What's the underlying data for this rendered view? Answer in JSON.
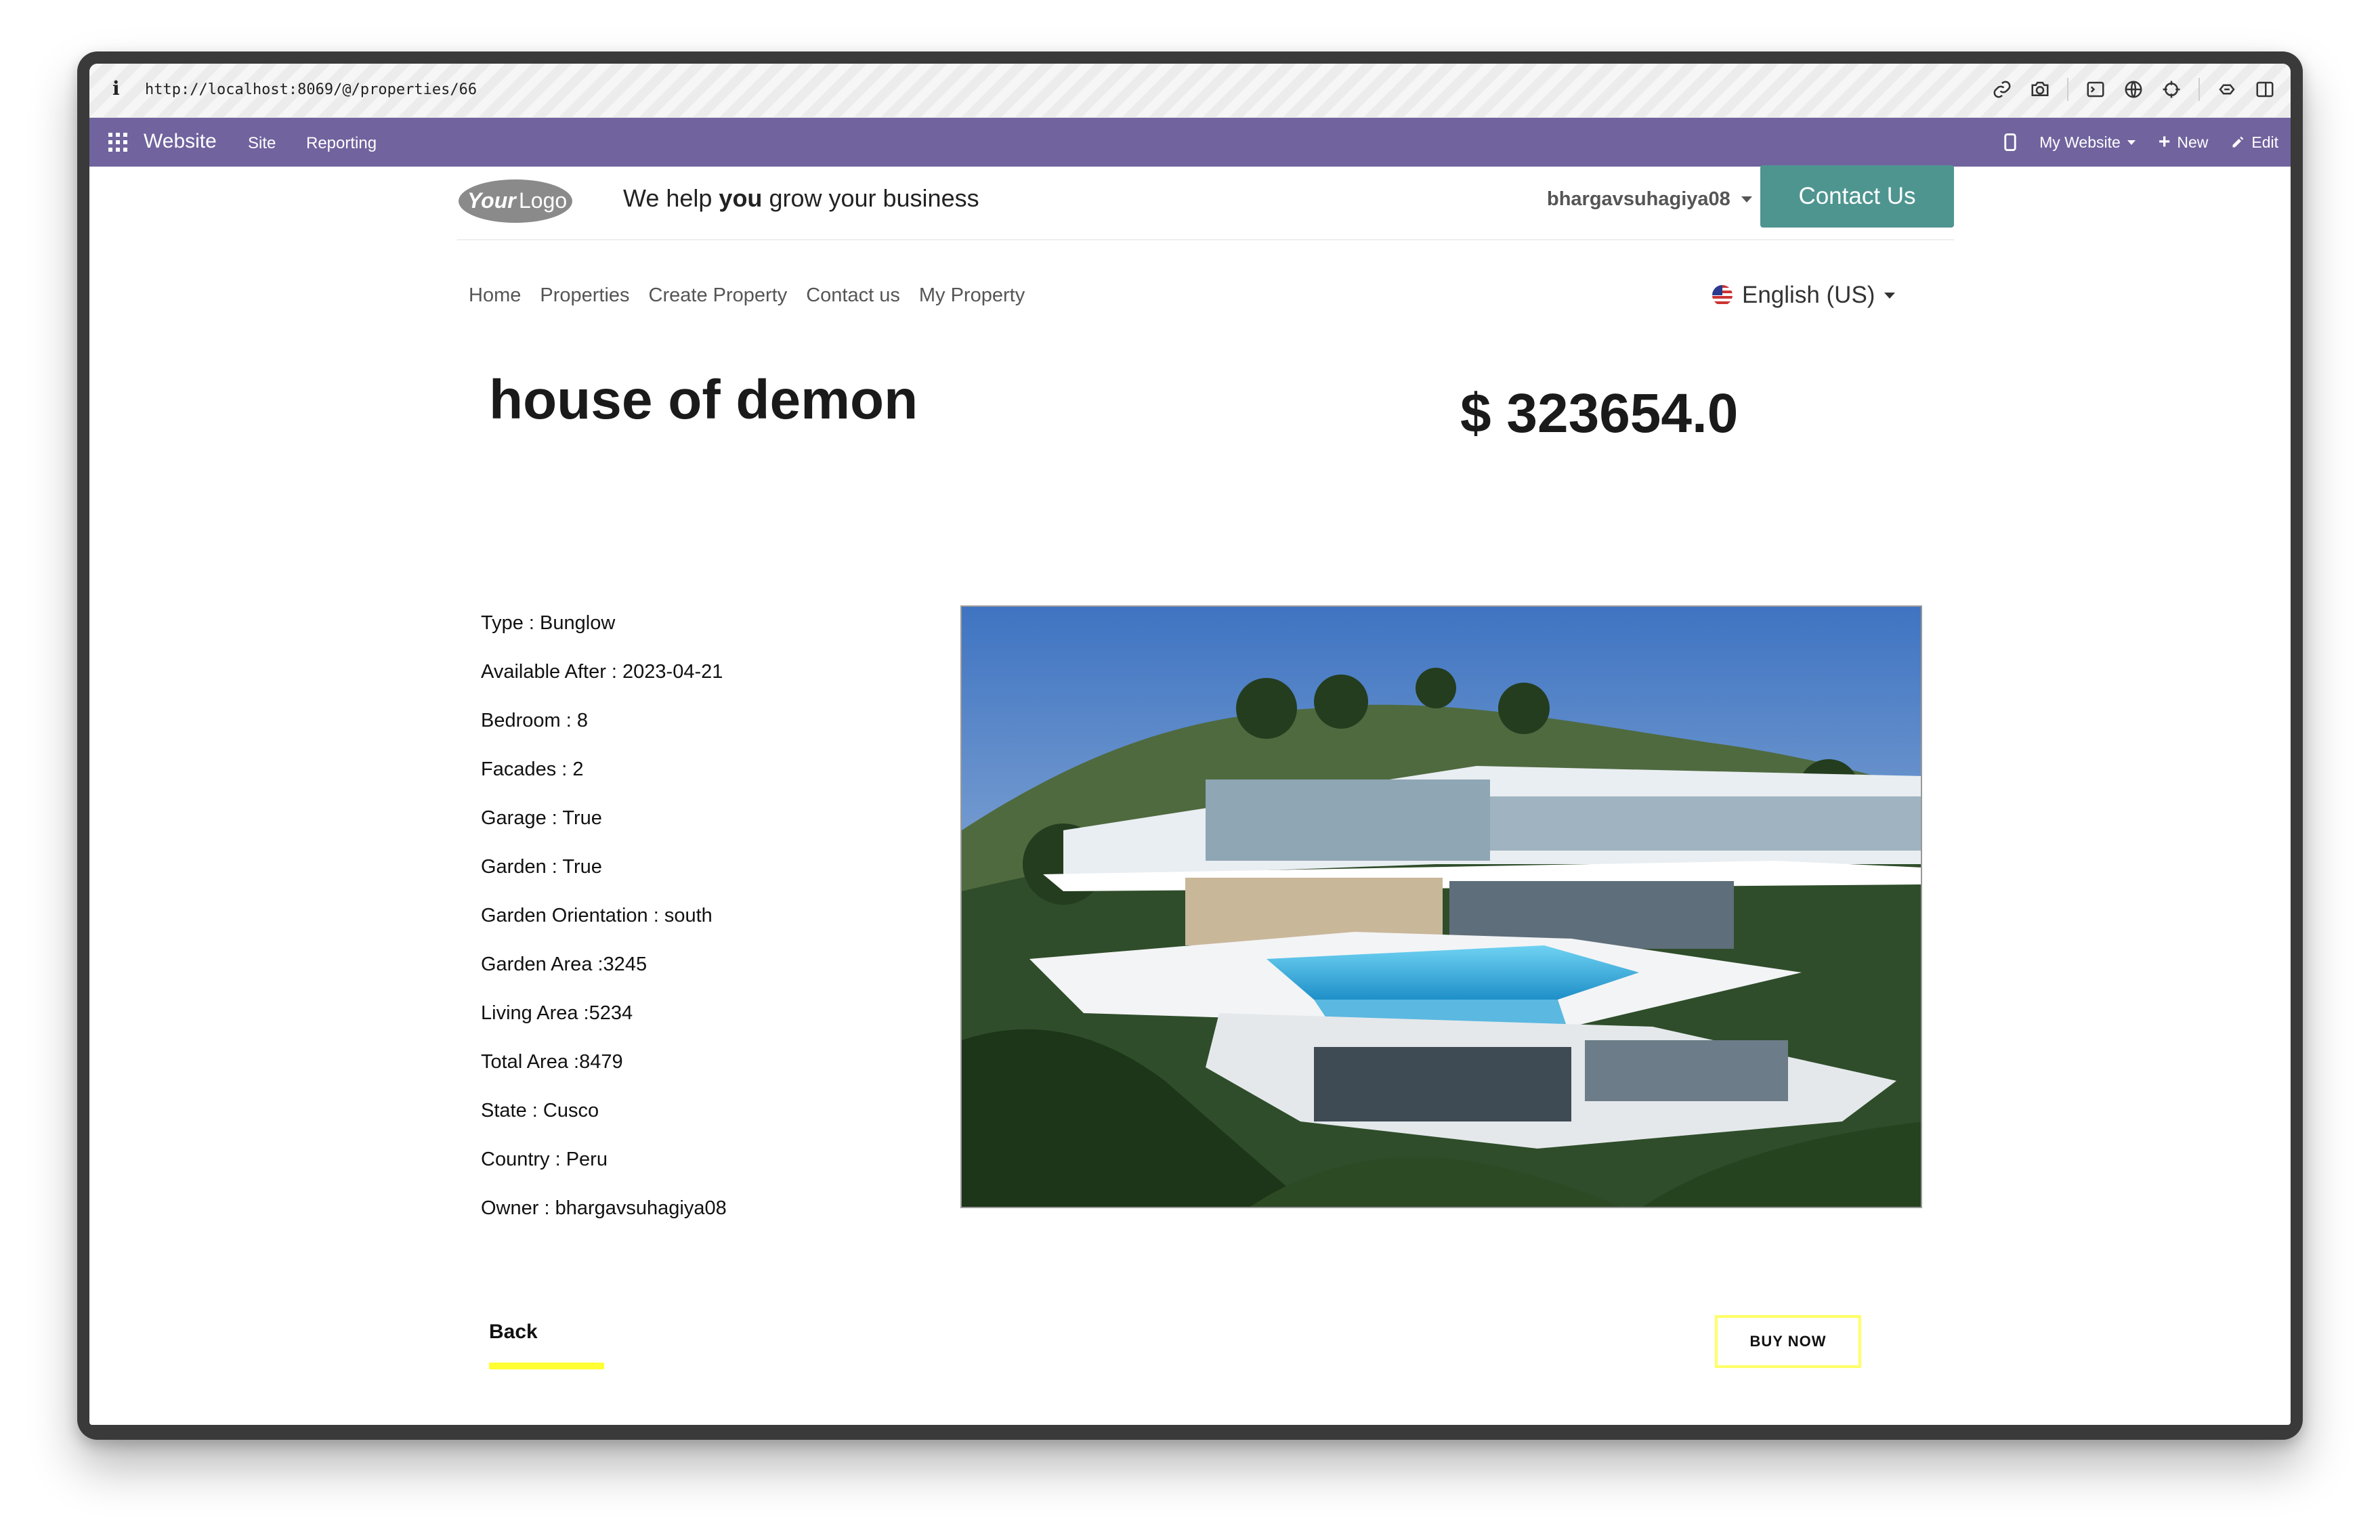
{
  "browser": {
    "url": "http://localhost:8069/@/properties/66",
    "info_icon": "info-icon",
    "toolbar_icons": [
      "link-icon",
      "camera-icon",
      "terminal-icon",
      "globe-icon",
      "crosshair-icon",
      "extension-icon",
      "sidebar-icon"
    ]
  },
  "odoo_bar": {
    "app_name": "Website",
    "menu": [
      "Site",
      "Reporting"
    ],
    "right": {
      "website_label": "My Website",
      "new_label": "New",
      "edit_label": "Edit"
    },
    "color": "#71639e"
  },
  "header": {
    "logo_text": "YourLogo",
    "tagline_pre": "We help ",
    "tagline_bold": "you",
    "tagline_post": " grow your business",
    "user": "bhargavsuhagiya08",
    "contact_button": "Contact Us",
    "contact_color": "#4e9590"
  },
  "nav": {
    "items": [
      "Home",
      "Properties",
      "Create Property",
      "Contact us",
      "My Property"
    ],
    "language": "English (US)"
  },
  "property": {
    "title": "house of demon",
    "price": "$ 323654.0",
    "details": [
      "Type : Bunglow",
      "Available After : 2023-04-21",
      "Bedroom : 8",
      "Facades : 2",
      "Garage : True",
      "Garden : True",
      "Garden Orientation : south",
      "Garden Area :3245",
      "Living Area :5234",
      "Total Area :8479",
      "State : Cusco",
      "Country : Peru",
      "Owner : bhargavsuhagiya08"
    ]
  },
  "actions": {
    "back": "Back",
    "buy": "BUY NOW",
    "accent": "#ffff33"
  }
}
